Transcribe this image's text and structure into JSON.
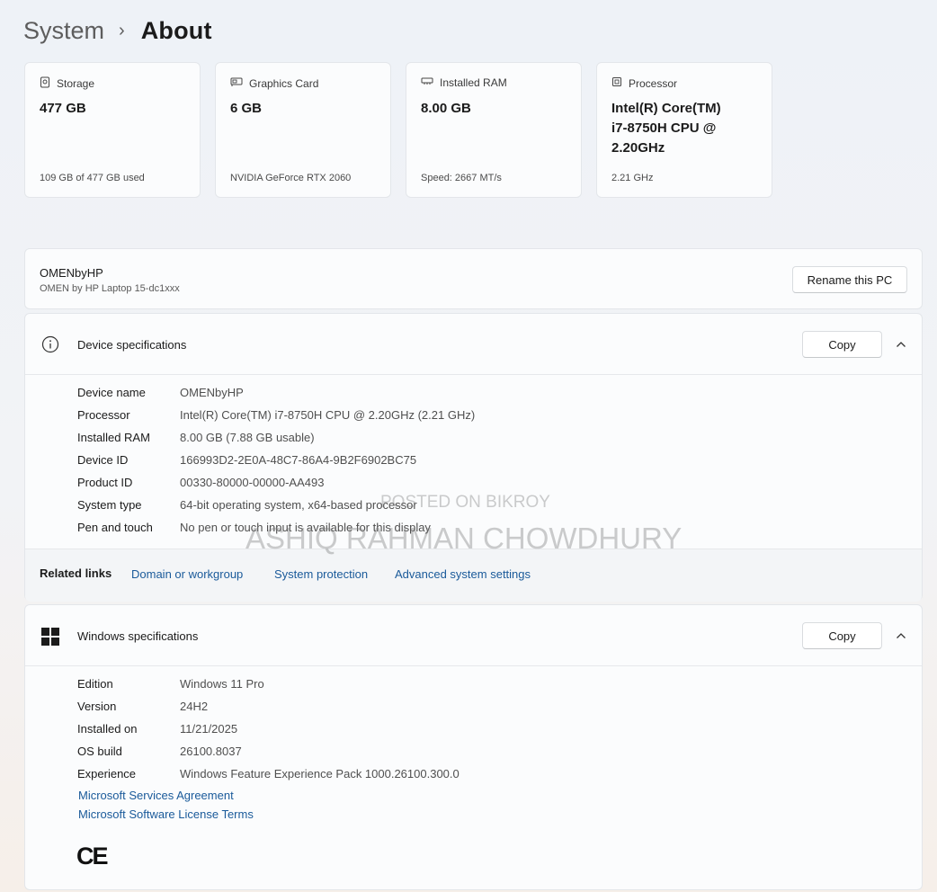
{
  "breadcrumb": {
    "parent": "System",
    "separator": "›",
    "current": "About"
  },
  "cards": [
    {
      "label": "Storage",
      "value": "477 GB",
      "sub": "109 GB of 477 GB used",
      "icon": "storage-icon"
    },
    {
      "label": "Graphics Card",
      "value": "6 GB",
      "sub": "NVIDIA GeForce RTX 2060",
      "icon": "graphics-card-icon"
    },
    {
      "label": "Installed RAM",
      "value": "8.00 GB",
      "sub": "Speed: 2667 MT/s",
      "icon": "ram-icon"
    },
    {
      "label": "Processor",
      "value": "Intel(R) Core(TM) i7-8750H CPU @ 2.20GHz",
      "sub": "2.21 GHz",
      "icon": "processor-icon"
    }
  ],
  "pc": {
    "name": "OMENbyHP",
    "model": "OMEN by HP Laptop 15-dc1xxx",
    "rename_label": "Rename this PC"
  },
  "device_specs": {
    "title": "Device specifications",
    "copy_label": "Copy",
    "rows": [
      {
        "label": "Device name",
        "value": "OMENbyHP"
      },
      {
        "label": "Processor",
        "value": "Intel(R) Core(TM) i7-8750H CPU @ 2.20GHz (2.21 GHz)"
      },
      {
        "label": "Installed RAM",
        "value": "8.00 GB (7.88 GB usable)"
      },
      {
        "label": "Device ID",
        "value": "166993D2-2E0A-48C7-86A4-9B2F6902BC75"
      },
      {
        "label": "Product ID",
        "value": "00330-80000-00000-AA493"
      },
      {
        "label": "System type",
        "value": "64-bit operating system, x64-based processor"
      },
      {
        "label": "Pen and touch",
        "value": "No pen or touch input is available for this display"
      }
    ]
  },
  "related": {
    "label": "Related links",
    "links": [
      "Domain or workgroup",
      "System protection",
      "Advanced system settings"
    ]
  },
  "windows_specs": {
    "title": "Windows specifications",
    "copy_label": "Copy",
    "rows": [
      {
        "label": "Edition",
        "value": "Windows 11 Pro"
      },
      {
        "label": "Version",
        "value": "24H2"
      },
      {
        "label": "Installed on",
        "value": "11/21/2025"
      },
      {
        "label": "OS build",
        "value": "26100.8037"
      },
      {
        "label": "Experience",
        "value": "Windows Feature Experience Pack 1000.26100.300.0"
      }
    ],
    "links": [
      "Microsoft Services Agreement",
      "Microsoft Software License Terms"
    ],
    "ce_mark": "CE"
  },
  "watermark": {
    "line1": "POSTED ON BIKROY",
    "line2": "ASHIQ RAHMAN CHOWDHURY"
  },
  "colors": {
    "link": "#1a5a9a",
    "accent": "#0067c0"
  }
}
